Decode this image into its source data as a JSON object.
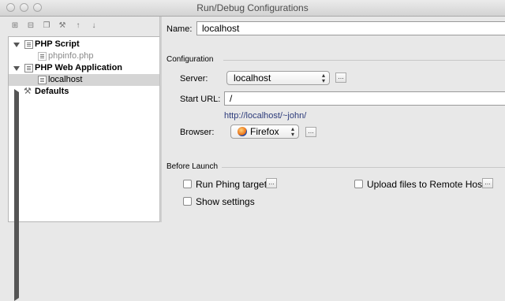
{
  "window": {
    "title": "Run/Debug Configurations"
  },
  "toolbar": {
    "icons": [
      "add-icon",
      "remove-icon",
      "copy-icon",
      "wrench-icon",
      "move-up-icon",
      "move-down-icon"
    ]
  },
  "tree": {
    "php_script": "PHP Script",
    "phpinfo": "phpinfo.php",
    "php_web_app": "PHP Web Application",
    "localhost": "localhost",
    "defaults": "Defaults"
  },
  "form": {
    "name_label": "Name:",
    "name_value": "localhost",
    "configuration_label": "Configuration",
    "server_label": "Server:",
    "server_value": "localhost",
    "start_url_label": "Start URL:",
    "start_url_value": "/",
    "url_hint": "http://localhost/~john/",
    "browser_label": "Browser:",
    "browser_value": "Firefox",
    "more_button": "...",
    "before_launch_label": "Before Launch",
    "run_phing": "Run Phing target",
    "upload_files": "Upload files to Remote Host",
    "show_settings": "Show settings"
  }
}
